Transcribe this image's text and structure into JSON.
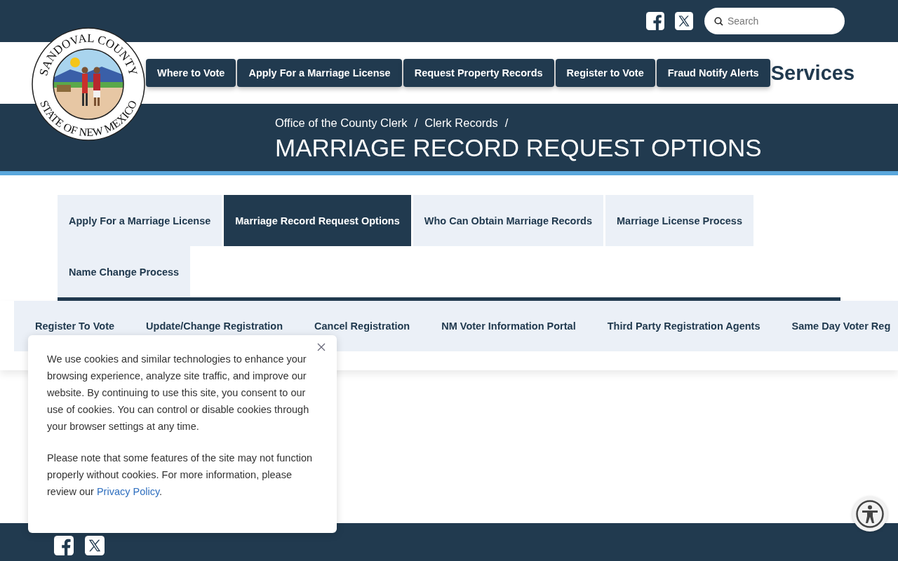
{
  "top_bar": {
    "social": [
      {
        "kind": "facebook"
      },
      {
        "kind": "x"
      }
    ],
    "search": {
      "placeholder": "Search"
    }
  },
  "seal": {
    "top_text": "SANDOVAL COUNTY",
    "bottom_text": "STATE OF NEW MEXICO"
  },
  "quick_links": [
    "Where to Vote",
    "Apply For a Marriage License",
    "Request Property Records",
    "Register to Vote",
    "Fraud Notify Alerts"
  ],
  "header_title": "Services",
  "breadcrumb": {
    "separator": "/",
    "items": [
      "Office of the County Clerk",
      "Clerk Records"
    ]
  },
  "page_title": "MARRIAGE RECORD REQUEST OPTIONS",
  "section_tabs": [
    {
      "label": "Apply For a Marriage License",
      "selected": false
    },
    {
      "label": "Marriage Record Request Options",
      "selected": true
    },
    {
      "label": "Who Can Obtain Marriage Records",
      "selected": false
    },
    {
      "label": "Marriage License Process",
      "selected": false
    },
    {
      "label": "Name Change Process",
      "selected": false
    }
  ],
  "voter_nav": [
    "Register To Vote",
    "Update/Change Registration",
    "Cancel Registration",
    "NM Voter Information Portal",
    "Third Party Registration Agents",
    "Same Day Voter Reg"
  ],
  "cookie_notice": {
    "paragraph_1": "We use cookies and similar technologies to enhance your browsing experience, analyze site traffic, and improve our website. By continuing to use this site, you consent to our use of cookies. You can control or disable cookies through your browser settings at any time.",
    "paragraph_2": {
      "before": "Please note that some features of the site may not function properly without cookies. For more information, please review our ",
      "link": "Privacy Policy",
      "after": "."
    }
  },
  "footer": {
    "social": [
      {
        "kind": "facebook"
      },
      {
        "kind": "x"
      }
    ]
  }
}
